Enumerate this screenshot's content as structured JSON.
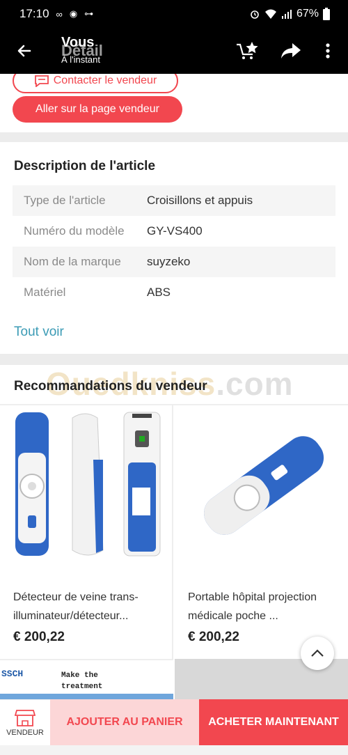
{
  "status_bar": {
    "time": "17:10",
    "left_icons": [
      "∞",
      "◉",
      "⊶"
    ],
    "battery_text": "67%"
  },
  "app_bar": {
    "title": "Vous",
    "title_ghost": "Détail",
    "subtitle": "À l'instant",
    "icons": [
      "back-arrow-icon",
      "cart-star-icon",
      "share-icon",
      "more-vert-icon"
    ]
  },
  "seller": {
    "contact_label": "Contacter le vendeur",
    "seller_page_label": "Aller sur la page vendeur"
  },
  "description": {
    "title": "Description de l'article",
    "rows": [
      {
        "key": "Type de l'article",
        "value": "Croisillons et appuis"
      },
      {
        "key": "Numéro du modèle",
        "value": "GY-VS400"
      },
      {
        "key": "Nom de la marque",
        "value": "suyzeko"
      },
      {
        "key": "Matériel",
        "value": "ABS"
      }
    ],
    "see_all": "Tout voir"
  },
  "recommendations": {
    "title": "Recommandations du vendeur",
    "watermark_main": "Ouedkniss",
    "watermark_suffix": ".com",
    "items": [
      {
        "name": "Détecteur de veine trans­illuminateur/détecteur...",
        "price": "€ 200,22"
      },
      {
        "name": "Portable hôpital projection médicale poche ...",
        "price": "€ 200,22"
      }
    ],
    "partial_banner": {
      "brand": "SSCH",
      "text_line1": "Make the",
      "text_line2": "treatment"
    }
  },
  "bottom_bar": {
    "vendor_label": "VENDEUR",
    "add_to_cart": "AJOUTER AU PANIER",
    "buy_now": "ACHETER MAINTENANT"
  },
  "colors": {
    "accent": "#f2474f",
    "link": "#3b9bb5",
    "product_blue": "#2f67c6"
  }
}
